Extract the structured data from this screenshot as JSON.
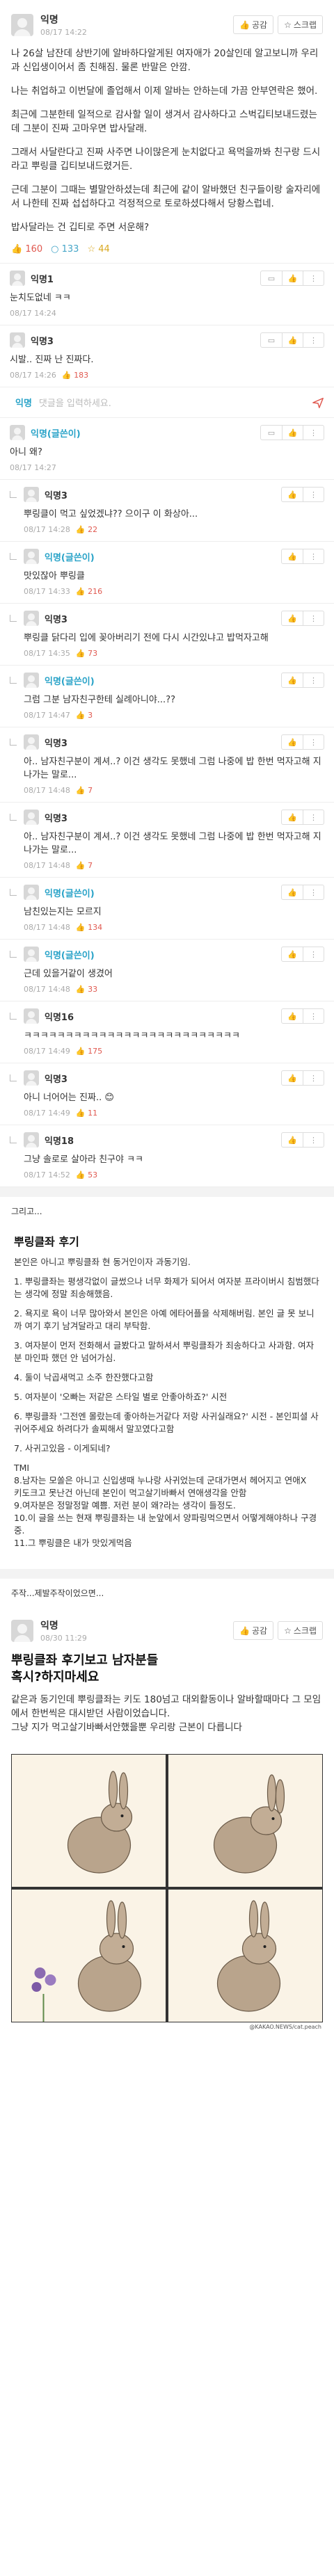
{
  "post": {
    "author": "익명",
    "date": "08/17 14:22",
    "like_btn": "공감",
    "scrap_btn": "스크랩",
    "paragraphs": [
      "나 26살 남잔데 상반기에 알바하다알게된 여자애가 20살인데 알고보니까 우리과 신입생이어서 좀 친해짐. 물론 반말은 안깜.",
      "나는 취업하고 이번달에 졸업해서 이제 알바는 안하는데 가끔 안부연락은 했어.",
      "최근에 그분한테 일적으로 감사할 일이 생겨서 감사하다고 스벅깁티보내드렸는데 그분이 진짜 고마우면 밥사달래.",
      "그래서 사달란다고 진짜 사주면 나이많은게 눈치없다고 욕먹을까봐 친구랑 드시라고 뿌링클 깁티보내드렸거든.",
      "근데 그분이 그때는 별말안하셨는데 최근에 같이 알바했던 친구들이랑 술자리에서 나한테 진짜 섭섭하다고 걱정적으로 토로하셨다해서 당황스럽네.",
      "밥사달라는 건 깁티로 주면 서운해?"
    ],
    "likes": "160",
    "comments": "133",
    "scraps": "44"
  },
  "comments_top": [
    {
      "name": "익명1",
      "text": "눈치도없네 ㅋㅋ",
      "date": "08/17 14:24",
      "likes": ""
    },
    {
      "name": "익명3",
      "text": "시발.. 진짜 난 진짜다.",
      "date": "08/17 14:26",
      "likes": "183"
    }
  ],
  "input": {
    "name": "익명",
    "placeholder": "댓글을 입력하세요."
  },
  "op_comment": {
    "name": "익명(글쓴이)",
    "text": "아니 왜?",
    "date": "08/17 14:27"
  },
  "replies": [
    {
      "name": "익명3",
      "op": false,
      "text": "뿌링클이 먹고 싶었겠냐?? 으이구 이 화상아...",
      "date": "08/17 14:28",
      "likes": "22"
    },
    {
      "name": "익명(글쓴이)",
      "op": true,
      "text": "맛있잖아 뿌링클",
      "date": "08/17 14:33",
      "likes": "216"
    },
    {
      "name": "익명3",
      "op": false,
      "text": "뿌링클 닭다리 입에 꽂아버리기 전에 다시 시간있냐고 밥먹자고해",
      "date": "08/17 14:35",
      "likes": "73"
    },
    {
      "name": "익명(글쓴이)",
      "op": true,
      "text": "그럼 그분 남자친구한테 실례아니야...??",
      "date": "08/17 14:47",
      "likes": "3"
    },
    {
      "name": "익명3",
      "op": false,
      "text": "아.. 남자친구분이 계셔..? 이건 생각도 못했네 그럼 나중에 밥 한번 먹자고해 지나가는 말로...",
      "date": "08/17 14:48",
      "likes": "7"
    },
    {
      "name": "익명3",
      "op": false,
      "text": "아.. 남자친구분이 계셔..? 이건 생각도 못했네 그럼 나중에 밥 한번 먹자고해 지나가는 말로...",
      "date": "08/17 14:48",
      "likes": "7"
    },
    {
      "name": "익명(글쓴이)",
      "op": true,
      "text": "남친있는지는 모르지",
      "date": "08/17 14:48",
      "likes": "134"
    },
    {
      "name": "익명(글쓴이)",
      "op": true,
      "text": "근데 있을거같이 생겼어",
      "date": "08/17 14:48",
      "likes": "33"
    },
    {
      "name": "익명16",
      "op": false,
      "text": "ㅋㅋㅋㅋㅋㅋㅋㅋㅋㅋㅋㅋㅋㅋㅋㅋㅋㅋㅋㅋㅋㅋㅋㅋㅋㅋ",
      "date": "08/17 14:49",
      "likes": "175"
    },
    {
      "name": "익명3",
      "op": false,
      "text": "아니 너어어는 진짜.. 😊",
      "date": "08/17 14:49",
      "likes": "11"
    },
    {
      "name": "익명18",
      "op": false,
      "text": "그냥 솔로로 살아라 친구야 ㅋㅋ",
      "date": "08/17 14:52",
      "likes": "53"
    }
  ],
  "caption": "그리고...",
  "review": {
    "title": "뿌링클좌 후기",
    "paragraphs": [
      "본인은 아니고 뿌링클좌 현 동거인이자 과동기임.",
      "1. 뿌링클좌는 평생각없이 글썼으나 너무 화제가 되어서 여자분 프라이버시 침범했다는 생각에 정말 죄송해했음.",
      "2. 욕지로 욕이 너무 많아와서 본인은 아예 에타어플을 삭제해버림. 본인 글 못 보니까 여기 후기 남겨달라고 대리 부탁함.",
      "3. 여자분이 먼저 전화해서 글봤다고 말하셔서 뿌링클좌가 죄송하다고 사과함. 여자분 마인파 했던 안 넘어가심.",
      "4. 둘이 낙곱새먹고 소주 한잔했다고함",
      "5. 여자분이 '오빠는 저같은 스타일 별로 안좋아하죠?' 시전",
      "6. 뿌링클좌 '그전엔 몰랐는데 좋아하는거같다 저랑 사귀실래요?' 시전 - 본인피셜 사귀어주세요 하려다가 솔찌해서 말꼬였다고함",
      "7. 사귀고있음 - 이게되네?",
      "TMI\n8.남자는 모쏠은 아니고 신입생때 누나랑 사귀었는데 군대가면서 헤어지고 연애X\n키도크고 못난건 아닌데 본인이 먹고살기바빠서 연애생각을 안함\n9.여자분은 정말정말 예쁨. 저런 분이 왜?라는 생각이 들정도.\n10.이 글을 쓰는 현재 뿌링클좌는 내 눈앞에서 양파링먹으면서 어떻게해야하나 구경중.\n11.그 뿌링클은 내가 맛있게먹음"
    ]
  },
  "caption2": "주작...제발주작이었으면...",
  "post2": {
    "author": "익명",
    "date": "08/30 11:29",
    "like_btn": "공감",
    "scrap_btn": "스크랩",
    "title": "뿌링클좌 후기보고 남자분들\n혹시?하지마세요",
    "paragraphs": [
      "같은과 동기인데 뿌링클좌는 키도 180넘고 대외활동이나 알바할때마다 그 모임에서 한번씩은 대시받던 사람이었습니다.\n그냥 지가 먹고살기바빠서안했을뿐 우리랑 근본이 다릅니다"
    ]
  },
  "comic_credit": "@KAKAO.NEWS/cat.peach"
}
